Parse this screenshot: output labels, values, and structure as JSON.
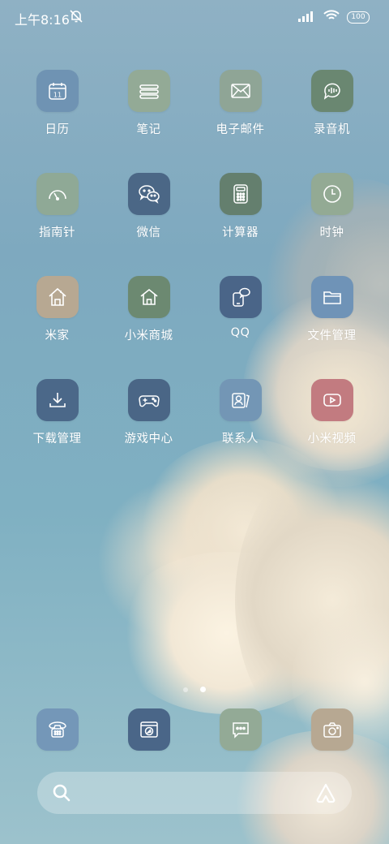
{
  "status_bar": {
    "time": "上午8:16",
    "mute_icon": "bell-off-icon",
    "signal_icon": "cell-signal-icon",
    "wifi_icon": "wifi-icon",
    "battery": "100"
  },
  "apps": [
    {
      "label": "日历",
      "icon": "calendar-icon",
      "color": "#6f93b3",
      "date": "11"
    },
    {
      "label": "笔记",
      "icon": "notes-icon",
      "color": "#93aa96"
    },
    {
      "label": "电子邮件",
      "icon": "mail-icon",
      "color": "#8fa596"
    },
    {
      "label": "录音机",
      "icon": "voice-recorder-icon",
      "color": "#6a8771"
    },
    {
      "label": "指南针",
      "icon": "compass-icon",
      "color": "#8fa996"
    },
    {
      "label": "微信",
      "icon": "wechat-icon",
      "color": "#4b6786"
    },
    {
      "label": "计算器",
      "icon": "calculator-icon",
      "color": "#647f6e"
    },
    {
      "label": "时钟",
      "icon": "clock-icon",
      "color": "#93aa94"
    },
    {
      "label": "米家",
      "icon": "home-icon",
      "color": "#b7a892"
    },
    {
      "label": "小米商城",
      "icon": "store-icon",
      "color": "#6c8971"
    },
    {
      "label": "QQ",
      "icon": "qq-icon",
      "color": "#4a6588"
    },
    {
      "label": "文件管理",
      "icon": "folder-icon",
      "color": "#6f93b7"
    },
    {
      "label": "下载管理",
      "icon": "download-icon",
      "color": "#4b6889"
    },
    {
      "label": "游戏中心",
      "icon": "gamepad-icon",
      "color": "#4a6686"
    },
    {
      "label": "联系人",
      "icon": "contacts-icon",
      "color": "#7396b5"
    },
    {
      "label": "小米视频",
      "icon": "video-play-icon",
      "color": "#c27b80"
    }
  ],
  "page_indicator": {
    "pages": 2,
    "current": 2
  },
  "dock": [
    {
      "icon": "phone-icon",
      "color": "#7497b8"
    },
    {
      "icon": "browser-icon",
      "color": "#4a6688"
    },
    {
      "icon": "messages-icon",
      "color": "#93aa96"
    },
    {
      "icon": "camera-icon",
      "color": "#b7a892"
    }
  ],
  "search_bar": {
    "search_icon": "search-icon",
    "assistant_icon": "assistant-icon"
  }
}
